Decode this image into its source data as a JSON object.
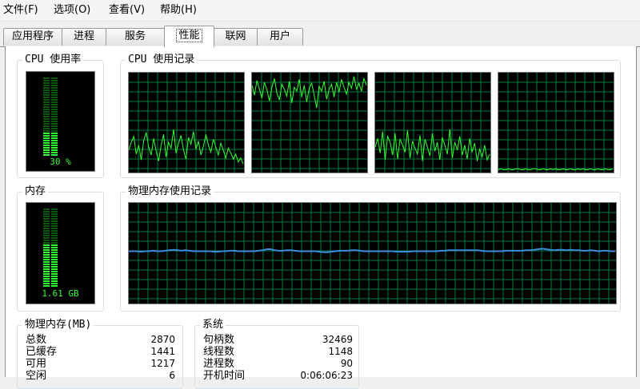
{
  "menu": [
    "文件(F)",
    "选项(O)",
    "查看(V)",
    "帮助(H)"
  ],
  "tabs": [
    {
      "label": "应用程序",
      "active": false
    },
    {
      "label": "进程",
      "active": false
    },
    {
      "label": "服务",
      "active": false
    },
    {
      "label": "性能",
      "active": true
    },
    {
      "label": "联网",
      "active": false
    },
    {
      "label": "用户",
      "active": false
    }
  ],
  "cpu": {
    "title": "CPU 使用率",
    "value_text": "30 %",
    "level": 0.3
  },
  "cpu_history": {
    "title": "CPU 使用记录",
    "cores": [
      [
        22,
        30,
        36,
        18,
        27,
        12,
        32,
        40,
        25,
        17,
        34,
        21,
        11,
        27,
        38,
        15,
        30,
        24,
        43,
        19,
        29,
        37,
        22,
        13,
        35,
        28,
        41,
        23,
        31,
        17,
        26,
        38,
        27,
        20,
        33,
        25,
        17,
        29,
        22,
        14,
        24,
        19,
        13,
        18,
        10,
        14,
        8
      ],
      [
        88,
        78,
        93,
        84,
        75,
        91,
        83,
        72,
        86,
        95,
        80,
        73,
        89,
        84,
        77,
        92,
        70,
        86,
        82,
        94,
        76,
        88,
        71,
        85,
        90,
        78,
        65,
        87,
        82,
        92,
        74,
        84,
        89,
        76,
        91,
        81,
        94,
        86,
        79,
        91,
        85,
        97,
        84,
        90,
        82,
        95,
        88
      ],
      [
        25,
        34,
        19,
        41,
        12,
        36,
        30,
        17,
        39,
        13,
        33,
        27,
        20,
        42,
        14,
        31,
        24,
        18,
        37,
        11,
        33,
        25,
        16,
        39,
        21,
        30,
        12,
        35,
        27,
        18,
        43,
        14,
        30,
        22,
        36,
        17,
        27,
        13,
        34,
        20,
        29,
        11,
        23,
        15,
        27,
        12,
        18
      ],
      [
        2,
        3,
        2,
        2,
        3,
        2,
        2,
        3,
        3,
        2,
        2,
        3,
        2,
        2,
        3,
        3,
        2,
        2,
        3,
        2,
        2,
        3,
        2,
        3,
        2,
        2,
        3,
        2,
        2,
        3,
        2,
        2,
        3,
        2,
        3,
        2,
        2,
        3,
        2,
        2,
        3,
        2,
        2,
        3,
        2,
        2,
        3
      ]
    ]
  },
  "memory": {
    "title": "内存",
    "value_text": "1.61 GB",
    "level": 0.56
  },
  "memory_history": {
    "title": "物理内存使用记录",
    "values": [
      52,
      52,
      52,
      51.5,
      52,
      52,
      52.5,
      52,
      52,
      52.5,
      53,
      53.5,
      53,
      52.5,
      53,
      52.5,
      52,
      52,
      52,
      52,
      52,
      51.5,
      51.5,
      52,
      52,
      52.5,
      52.5,
      52,
      52,
      52,
      52,
      52,
      52.5,
      53,
      54,
      54,
      53,
      52.5,
      52.5,
      53,
      53,
      52.5,
      52,
      52,
      52,
      52,
      52,
      51.5,
      51,
      51,
      51.5,
      52,
      52.5,
      52.5,
      52.5,
      53,
      53,
      52.5,
      52,
      52,
      52,
      52,
      52,
      52,
      52,
      52,
      51.5,
      51.5,
      51.5,
      51.5,
      52,
      52,
      52,
      52,
      52,
      52,
      52,
      52.5,
      52.5,
      53,
      53,
      53,
      53,
      53,
      53,
      53,
      53,
      52.5,
      52,
      52,
      52,
      52,
      52,
      52.5,
      52.5,
      52.5,
      52.5,
      52.5,
      53,
      53,
      53.5,
      54,
      54.5,
      54,
      53.5,
      53,
      53.5,
      53.5,
      53,
      53.5,
      53,
      53,
      52.5,
      52.5,
      53,
      52.5,
      52,
      52.5,
      52.5,
      52,
      52
    ]
  },
  "physical_memory": {
    "title": "物理内存(MB)",
    "rows": [
      {
        "label": "总数",
        "value": "2870"
      },
      {
        "label": "已缓存",
        "value": "1441"
      },
      {
        "label": "可用",
        "value": "1217"
      },
      {
        "label": "空闲",
        "value": "6"
      }
    ]
  },
  "system": {
    "title": "系统",
    "rows": [
      {
        "label": "句柄数",
        "value": "32469"
      },
      {
        "label": "线程数",
        "value": "1148"
      },
      {
        "label": "进程数",
        "value": "90"
      },
      {
        "label": "开机时间",
        "value": "0:06:06:23"
      }
    ]
  },
  "colors": {
    "graph_bg": "#000000",
    "grid": "#008040",
    "cpu_line": "#32ff32",
    "meter_on": "#32ff32",
    "meter_off": "#0a570a",
    "memory_line": "#3c8ddc"
  }
}
